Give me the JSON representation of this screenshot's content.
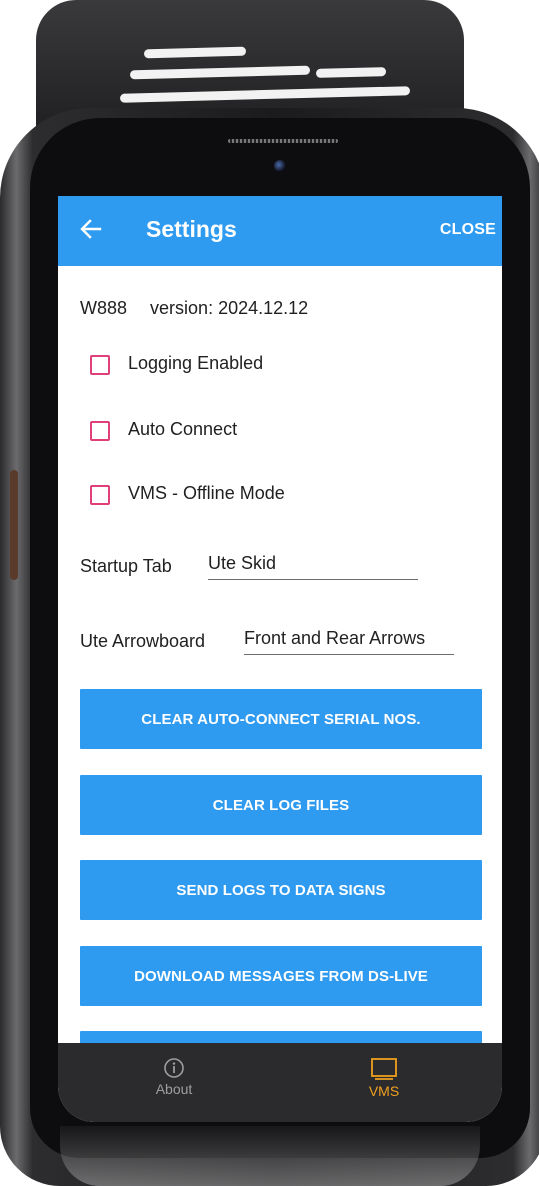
{
  "app_bar": {
    "title": "Settings",
    "close_label": "CLOSE"
  },
  "info": {
    "model": "W888",
    "version_text": "version: 2024.12.12"
  },
  "checkboxes": [
    {
      "label": "Logging Enabled",
      "checked": false
    },
    {
      "label": "Auto Connect",
      "checked": false
    },
    {
      "label": "VMS - Offline Mode",
      "checked": false
    }
  ],
  "startup_tab": {
    "label": "Startup Tab",
    "value": "Ute Skid"
  },
  "ute_arrowboard": {
    "label": "Ute Arrowboard",
    "value": "Front and Rear Arrows"
  },
  "buttons": {
    "clear_serials": "CLEAR AUTO-CONNECT SERIAL NOS.",
    "clear_logs": "CLEAR LOG FILES",
    "send_logs": "SEND LOGS TO DATA SIGNS",
    "download_messages": "DOWNLOAD MESSAGES FROM DS-LIVE"
  },
  "bottom_nav": {
    "about": "About",
    "vms": "VMS",
    "active": "VMS"
  },
  "colors": {
    "primary": "#2f9bf0",
    "checkbox_border": "#e0407a",
    "nav_background": "#2b2b2d",
    "nav_active": "#f0a020",
    "nav_inactive": "#9e9e9e"
  }
}
